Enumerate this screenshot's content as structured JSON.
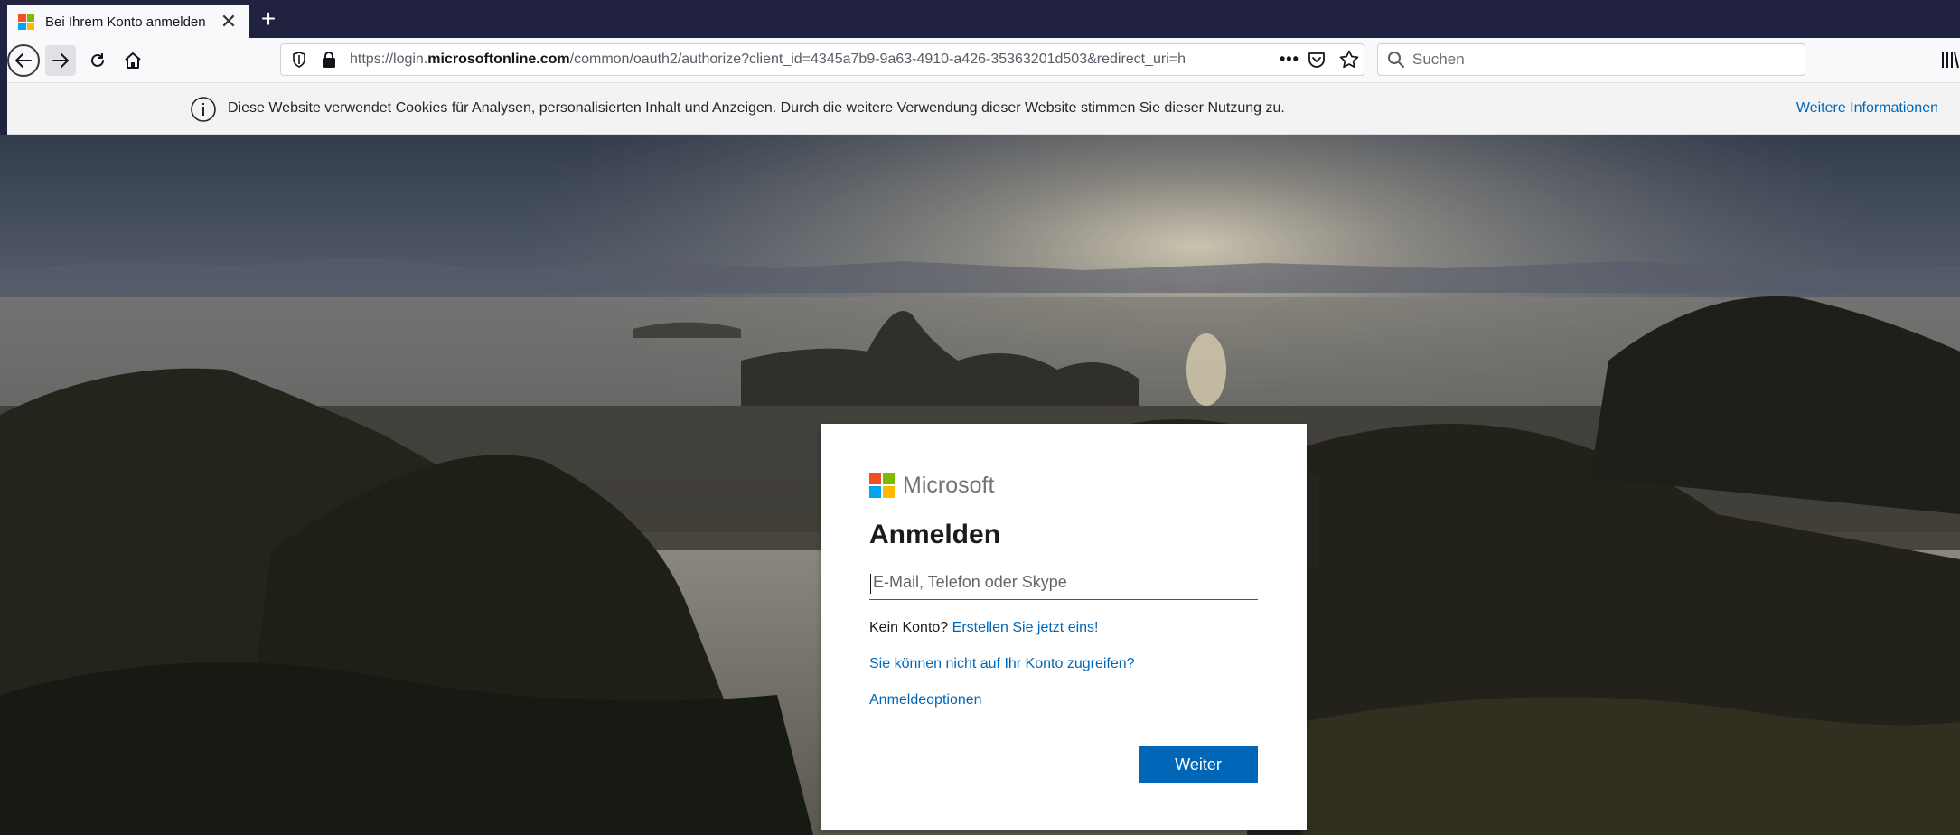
{
  "browser": {
    "tab": {
      "title": "Bei Ihrem Konto anmelden"
    },
    "url": {
      "prefix": "https://login.",
      "domain": "microsoftonline.com",
      "path": "/common/oauth2/authorize?client_id=4345a7b9-9a63-4910-a426-35363201d503&redirect_uri=h"
    },
    "page_actions_label": "•••",
    "search": {
      "placeholder": "Suchen"
    }
  },
  "cookie_notice": {
    "message": "Diese Website verwendet Cookies für Analysen, personalisierten Inhalt und Anzeigen. Durch die weitere Verwendung dieser Website stimmen Sie dieser Nutzung zu.",
    "link": "Weitere Informationen"
  },
  "signin": {
    "brand": "Microsoft",
    "heading": "Anmelden",
    "input_placeholder": "E-Mail, Telefon oder Skype",
    "no_account_prefix": "Kein Konto?",
    "create_link": "Erstellen Sie jetzt eins!",
    "cant_access_link": "Sie können nicht auf Ihr Konto zugreifen?",
    "options_link": "Anmeldeoptionen",
    "next_button": "Weiter"
  },
  "colors": {
    "ms_red": "#f25022",
    "ms_green": "#7fba00",
    "ms_blue": "#00a4ef",
    "ms_yellow": "#ffb900",
    "accent": "#0067b8",
    "tabstrip": "#20223f"
  }
}
